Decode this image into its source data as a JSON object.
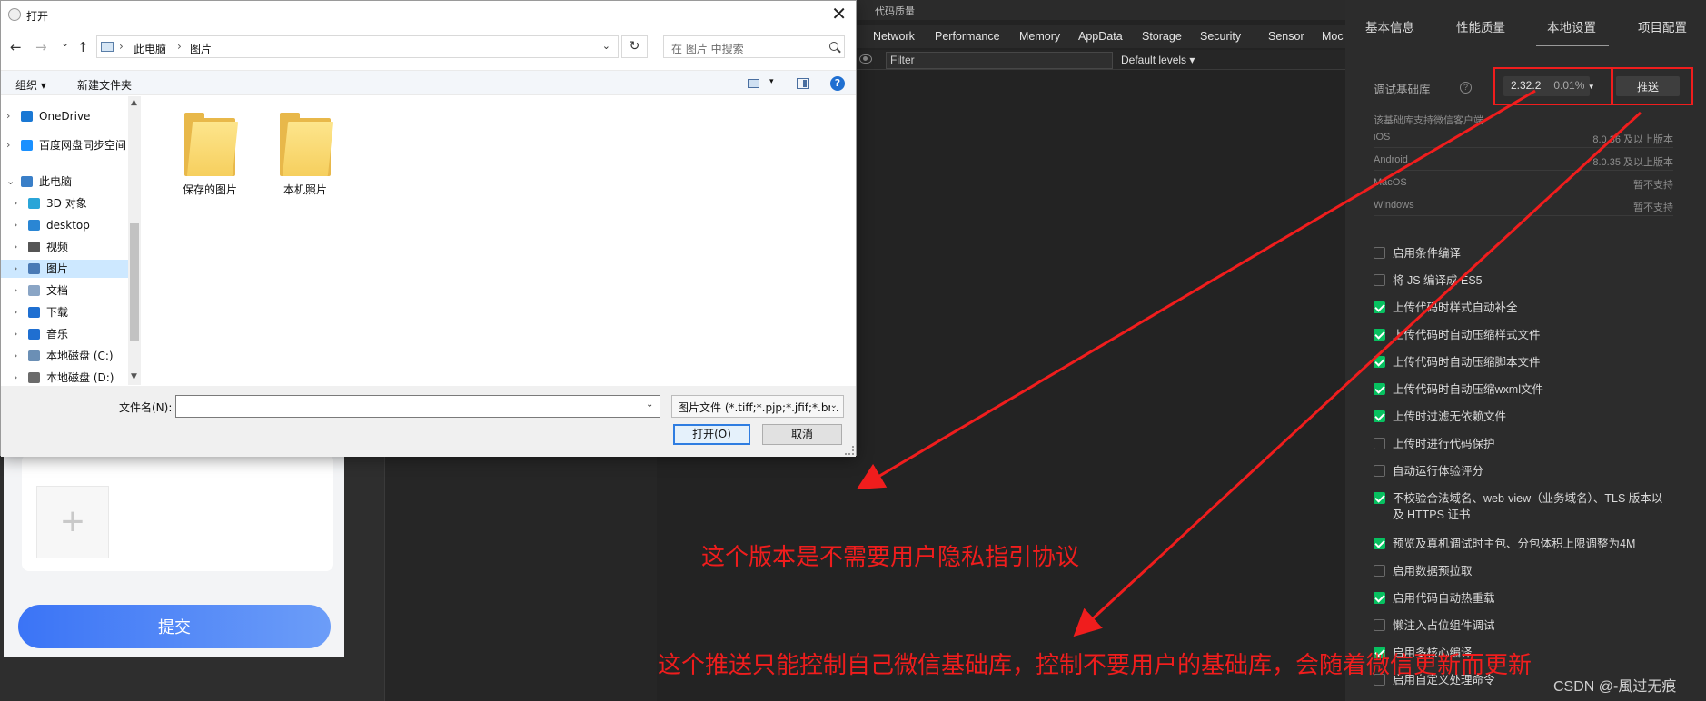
{
  "devtools": {
    "top_label": "代码质量",
    "tabs": [
      "Network",
      "Performance",
      "Memory",
      "AppData",
      "Storage",
      "Security",
      "Sensor",
      "Moc"
    ],
    "filter_placeholder": "Filter",
    "levels_label": "Default levels ▾"
  },
  "simulator": {
    "submit_label": "提交",
    "add_symbol": "+"
  },
  "settings": {
    "tabs": [
      "基本信息",
      "性能质量",
      "本地设置",
      "项目配置"
    ],
    "active_tab": "本地设置",
    "debug_lib_label": "调试基础库",
    "help_symbol": "?",
    "version": "2.32.2",
    "version_percent": "0.01%",
    "push_label": "推送",
    "support_note": "该基础库支持微信客户端",
    "os_rows": [
      {
        "name": "iOS",
        "value": "8.0.36 及以上版本"
      },
      {
        "name": "Android",
        "value": "8.0.35 及以上版本"
      },
      {
        "name": "MacOS",
        "value": "暂不支持"
      },
      {
        "name": "Windows",
        "value": "暂不支持"
      }
    ],
    "options": [
      {
        "label": "启用条件编译",
        "checked": false
      },
      {
        "label": "将 JS 编译成 ES5",
        "checked": false
      },
      {
        "label": "上传代码时样式自动补全",
        "checked": true
      },
      {
        "label": "上传代码时自动压缩样式文件",
        "checked": true
      },
      {
        "label": "上传代码时自动压缩脚本文件",
        "checked": true
      },
      {
        "label": "上传代码时自动压缩wxml文件",
        "checked": true
      },
      {
        "label": "上传时过滤无依赖文件",
        "checked": true
      },
      {
        "label": "上传时进行代码保护",
        "checked": false
      },
      {
        "label": "自动运行体验评分",
        "checked": false
      },
      {
        "label": "不校验合法域名、web-view（业务域名）、TLS 版本以及 HTTPS 证书",
        "checked": true
      },
      {
        "label": "预览及真机调试时主包、分包体积上限调整为4M",
        "checked": true
      },
      {
        "label": "启用数据预拉取",
        "checked": false
      },
      {
        "label": "启用代码自动热重载",
        "checked": true
      },
      {
        "label": "懒注入占位组件调试",
        "checked": false
      },
      {
        "label": "启用多核心编译",
        "checked": true
      },
      {
        "label": "启用自定义处理命令",
        "checked": false
      }
    ]
  },
  "annotations": {
    "text1": "这个版本是不需要用户隐私指引协议",
    "text2": "这个推送只能控制自己微信基础库，控制不要用户的基础库，会随着微信更新而更新",
    "color": "#f01d1d"
  },
  "watermark": "CSDN @-風过无痕",
  "dialog": {
    "title": "打开",
    "close_symbol": "✕",
    "nav": {
      "back": "←",
      "forward": "→",
      "recent": "⌄",
      "up": "↑"
    },
    "breadcrumb": [
      "此电脑",
      "图片"
    ],
    "breadcrumb_sep": "›",
    "refresh_symbol": "↻",
    "search_placeholder": "在 图片 中搜索",
    "toolbar": {
      "organize": "组织 ▾",
      "new_folder": "新建文件夹",
      "view_dd": "▾",
      "help": "?"
    },
    "sidebar": [
      {
        "label": "OneDrive",
        "icon_color": "#1a78d4",
        "indent": 0,
        "chevron": "›",
        "selected": false
      },
      {
        "label": "百度网盘同步空间",
        "icon_color": "#1a90ff",
        "indent": 0,
        "chevron": "›",
        "selected": false
      },
      {
        "label": "此电脑",
        "icon_color": "#3a7fc8",
        "indent": 0,
        "chevron": "⌄",
        "selected": false
      },
      {
        "label": "3D 对象",
        "icon_color": "#2aa5d8",
        "indent": 1,
        "chevron": "›",
        "selected": false
      },
      {
        "label": "desktop",
        "icon_color": "#2a86d4",
        "indent": 1,
        "chevron": "›",
        "selected": false
      },
      {
        "label": "视频",
        "icon_color": "#555555",
        "indent": 1,
        "chevron": "›",
        "selected": false
      },
      {
        "label": "图片",
        "icon_color": "#4a7ab5",
        "indent": 1,
        "chevron": "›",
        "selected": true
      },
      {
        "label": "文档",
        "icon_color": "#8aa5c5",
        "indent": 1,
        "chevron": "›",
        "selected": false
      },
      {
        "label": "下载",
        "icon_color": "#1f6fd1",
        "indent": 1,
        "chevron": "›",
        "selected": false
      },
      {
        "label": "音乐",
        "icon_color": "#1f6fd1",
        "indent": 1,
        "chevron": "›",
        "selected": false
      },
      {
        "label": "本地磁盘 (C:)",
        "icon_color": "#6b8fb5",
        "indent": 1,
        "chevron": "›",
        "selected": false
      },
      {
        "label": "本地磁盘 (D:)",
        "icon_color": "#6b6b6b",
        "indent": 1,
        "chevron": "›",
        "selected": false
      }
    ],
    "scroll_up": "▲",
    "scroll_down": "▼",
    "folders": [
      "保存的图片",
      "本机照片"
    ],
    "filename_label": "文件名(N):",
    "filename_value": "",
    "dropdown_symbol": "⌄",
    "filetype_value": "图片文件 (*.tiff;*.pjp;*.jfif;*.bm",
    "open_label": "打开(O)",
    "cancel_label": "取消"
  }
}
